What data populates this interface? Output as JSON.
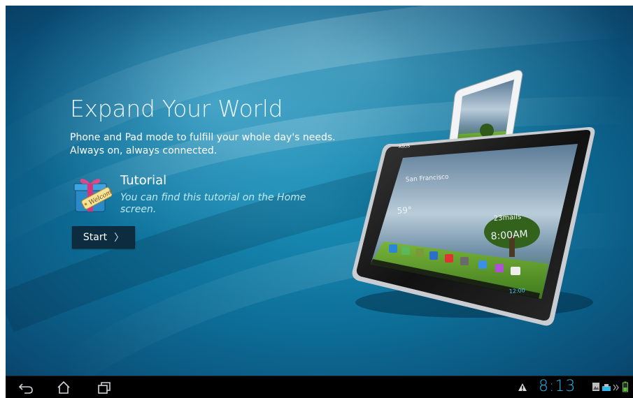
{
  "screen": {
    "title": "Expand Your World",
    "subtitle_line1": "Phone and Pad mode to fulfill your whole day's needs.",
    "subtitle_line2": "Always on, always connected."
  },
  "tutorial": {
    "icon": "welcome-gift-icon",
    "icon_text": "Welcome",
    "title": "Tutorial",
    "description": "You can find this tutorial on the Home screen.",
    "start_label": "Start",
    "start_chevron": "〉"
  },
  "devices_image": {
    "tablet_brand": "ASUS",
    "weather_city": "San Francisco",
    "weather_temp": "59°",
    "widget_time": "8:00AM",
    "widget_mails": "23mails",
    "tablet_clock": "12:00"
  },
  "navbar": {
    "back_icon": "back-icon",
    "home_icon": "home-icon",
    "recent_icon": "recent-apps-icon",
    "clock": "8:13",
    "warning_icon": "warning-icon",
    "status_icons": [
      "image-notification-icon",
      "dock-icon",
      "overflow-icon",
      "battery-icon"
    ],
    "accent": "#2fb6ea"
  }
}
